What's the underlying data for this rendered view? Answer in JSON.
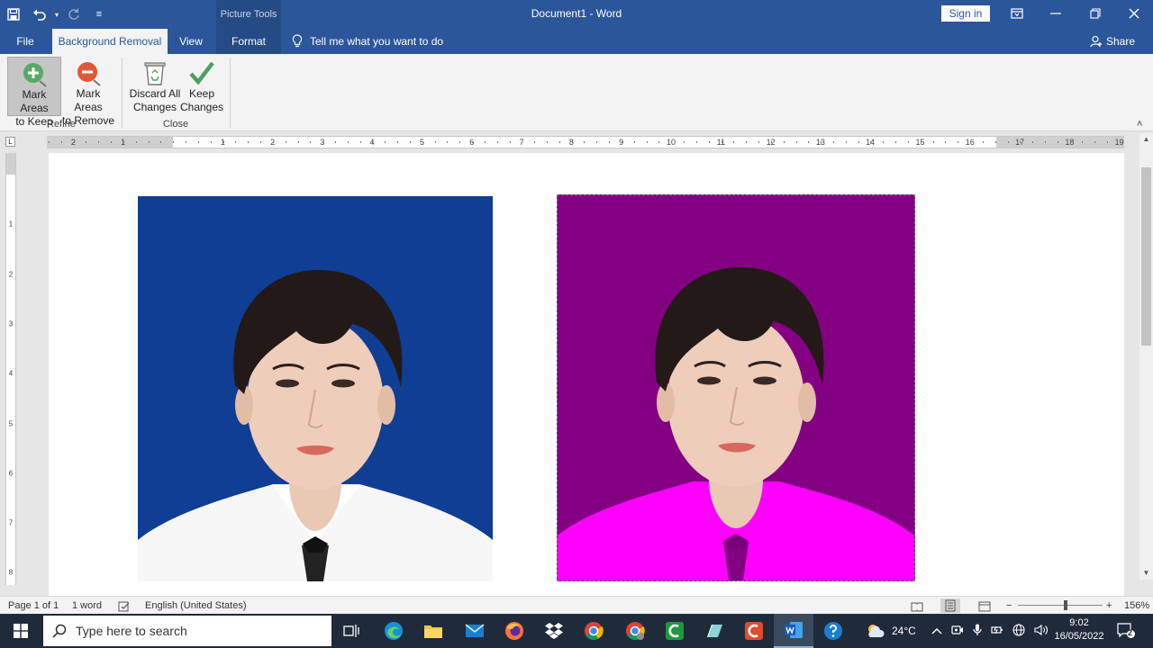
{
  "titlebar": {
    "doc_title": "Document1  -  Word",
    "context_tools": "Picture Tools",
    "signin": "Sign in",
    "qat_customize": "≡"
  },
  "tabs": {
    "file": "File",
    "background_removal": "Background Removal",
    "view": "View",
    "format": "Format",
    "tell_me": "Tell me what you want to do",
    "share": "Share"
  },
  "ribbon": {
    "mark_keep": [
      "Mark Areas",
      "to Keep"
    ],
    "mark_remove": [
      "Mark Areas",
      "to Remove"
    ],
    "discard": [
      "Discard All",
      "Changes"
    ],
    "keep": [
      "Keep",
      "Changes"
    ],
    "group_refine": "Refine",
    "group_close": "Close",
    "collapse": "˄"
  },
  "ruler": {
    "h_left": [
      "2",
      "1"
    ],
    "h_right": [
      "1",
      "2",
      "3",
      "4",
      "5",
      "6",
      "7",
      "8",
      "9",
      "10",
      "11",
      "12",
      "13",
      "14",
      "15",
      "16",
      "17",
      "18",
      "19"
    ],
    "v": [
      "1",
      "2",
      "3",
      "4",
      "5",
      "6",
      "7",
      "8"
    ],
    "tab_selector": "L"
  },
  "status": {
    "page": "Page 1 of 1",
    "words": "1 word",
    "language": "English (United States)",
    "zoom": "156%",
    "zoom_out": "−",
    "zoom_in": "+"
  },
  "taskbar": {
    "search_placeholder": "Type here to search",
    "weather": "24°C",
    "time": "9:02",
    "date": "16/05/2022",
    "notification_count": "2"
  },
  "colors": {
    "word_blue": "#2b579a",
    "photo1_bg": "#0f3e94",
    "photo2_bg": "#830083",
    "photo2_shirt": "#ff00ff"
  }
}
